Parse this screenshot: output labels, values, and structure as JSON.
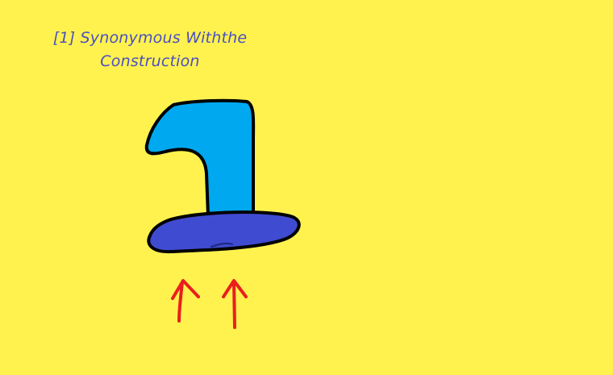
{
  "caption": {
    "line1": "[1] Synonymous Withthe",
    "line2": "Construction"
  },
  "colors": {
    "background": "#FFF24F",
    "caption_text": "#4B4FC0",
    "hat_crown": "#00A8F0",
    "hat_brim": "#3F4BD0",
    "outline": "#000000",
    "arrows": "#E8201E"
  },
  "icons": {
    "hat": "wizard-hat-icon",
    "arrow_left": "arrow-up-icon",
    "arrow_right": "arrow-up-icon"
  }
}
